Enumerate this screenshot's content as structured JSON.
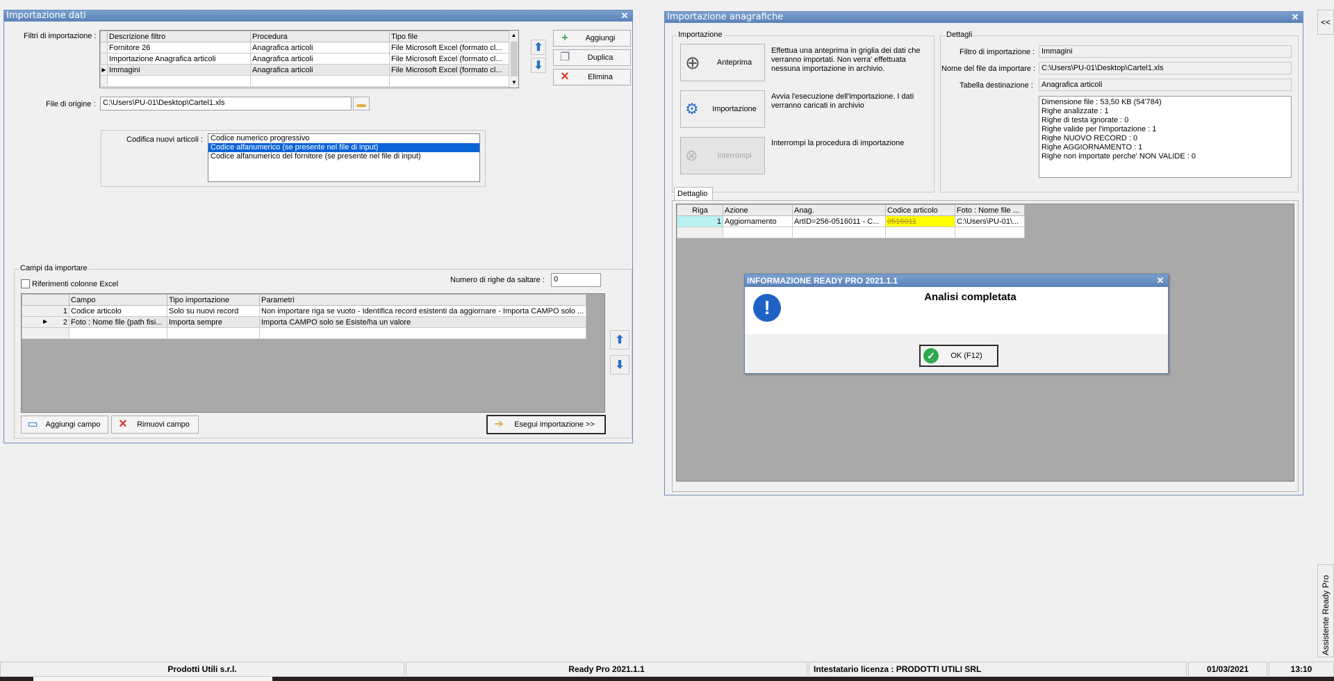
{
  "left_window": {
    "title": "Importazione dati",
    "filters_label": "Filtri di importazione :",
    "filters_headers": [
      "Descrizione filtro",
      "Procedura",
      "Tipo file"
    ],
    "filters_rows": [
      {
        "desc": "Fornitore 26",
        "proc": "Anagrafica articoli",
        "type": "File Microsoft Excel (formato cl..."
      },
      {
        "desc": "Importazione Anagrafica articoli",
        "proc": "Anagrafica articoli",
        "type": "File Microsoft Excel (formato cl..."
      },
      {
        "desc": "Immagini",
        "proc": "Anagrafica articoli",
        "type": "File Microsoft Excel (formato cl..."
      }
    ],
    "btn_add": "Aggiungi",
    "btn_duplicate": "Duplica",
    "btn_delete": "Elimina",
    "source_label": "File di origine :",
    "source_value": "C:\\Users\\PU-01\\Desktop\\Cartel1.xls",
    "codifica_label": "Codifica nuovi articoli :",
    "codifica_options": [
      "Codice numerico progressivo",
      "Codice alfanumerico (se presente nel file di input)",
      "Codice alfanumerico del fornitore (se presente nel file di input)"
    ],
    "campi_title": "Campi da importare",
    "excel_ref_label": "Riferimenti colonne Excel",
    "skip_rows_label": "Numero di righe da saltare :",
    "skip_rows_value": "0",
    "campi_headers": [
      "Campo",
      "Tipo importazione",
      "Parametri"
    ],
    "campi_rows": [
      {
        "n": "1",
        "campo": "Codice articolo",
        "tipo": "Solo su nuovi record",
        "param": "Non importare riga se vuoto - Identifica record esistenti da aggiornare - Importa CAMPO solo ..."
      },
      {
        "n": "2",
        "campo": "Foto : Nome file (path fisi...",
        "tipo": "Importa sempre",
        "param": "Importa CAMPO solo se Esiste/ha un valore"
      }
    ],
    "btn_add_field": "Aggiungi campo",
    "btn_remove_field": "Rimuovi campo",
    "btn_execute": "Esegui importazione >>"
  },
  "right_window": {
    "title": "Importazione anagrafiche",
    "group_import": "Importazione",
    "btn_preview": "Anteprima",
    "preview_desc": "Effettua una anteprima in griglia dei dati che verranno importati. Non verra' effettuata nessuna importazione in archivio.",
    "btn_import": "Importazione",
    "import_desc": "Avvia l'esecuzione dell'importazione. I dati verranno caricati in archivio",
    "btn_stop": "Interrompi",
    "stop_desc": "Interrompi la procedura di importazione",
    "group_details": "Dettagli",
    "filter_label": "Filtro di importazione :",
    "filter_value": "Immagini",
    "file_label": "Nome del file da importare :",
    "file_value": "C:\\Users\\PU-01\\Desktop\\Cartel1.xls",
    "table_label": "Tabella destinazione :",
    "table_value": "Anagrafica articoli",
    "stats": [
      "Dimensione file : 53,50 KB (54'784)",
      "Righe analizzate : 1",
      "Righe di testa ignorate : 0",
      "Righe valide per l'importazione : 1",
      "Righe NUOVO RECORD : 0",
      "Righe AGGIORNAMENTO  : 1",
      "Righe non importate perche' NON VALIDE : 0"
    ],
    "tab_label": "Dettaglio",
    "detail_headers": [
      "Riga",
      "Azione",
      "Anag.",
      "Codice articolo",
      "Foto : Nome file ..."
    ],
    "detail_rows": [
      {
        "riga": "1",
        "azione": "Aggiornamento",
        "anag": "ArtID=256-0516011 - C...",
        "codice": "0516011",
        "foto": "C:\\Users\\PU-01\\..."
      }
    ]
  },
  "dialog": {
    "title": "INFORMAZIONE READY PRO 2021.1.1",
    "message": "Analisi completata",
    "ok_label": "OK (F12)"
  },
  "side_tab": {
    "collapse_glyph": "<<",
    "assistant_label": "Assistente Ready Pro"
  },
  "statusbar": {
    "company": "Prodotti Utili s.r.l.",
    "app": "Ready Pro 2021.1.1",
    "license": "Intestatario licenza : PRODOTTI UTILI SRL",
    "date": "01/03/2021",
    "time": "13:10"
  },
  "colors": {
    "titlebar": "#5b82b7",
    "selection": "#0a64d8",
    "highlight_yellow": "#ffff00",
    "row_cyan": "#b9f0f0"
  }
}
